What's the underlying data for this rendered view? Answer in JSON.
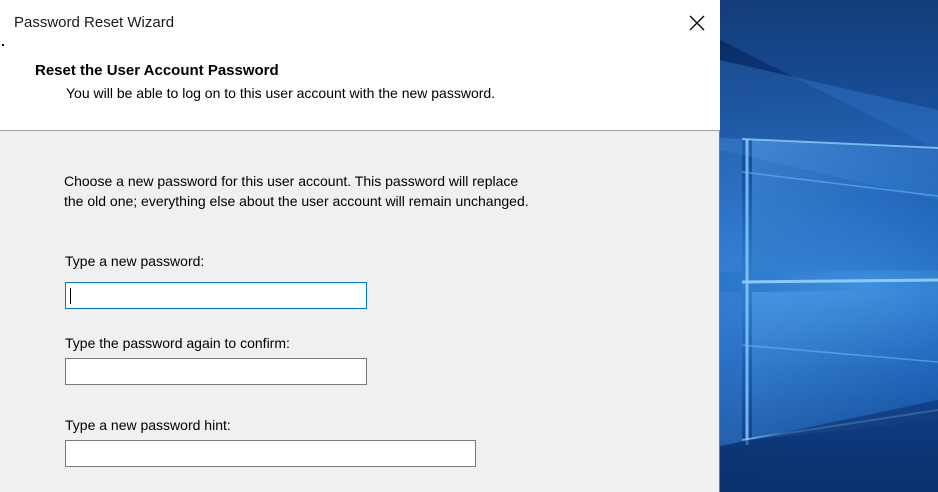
{
  "window": {
    "title": "Password Reset Wizard"
  },
  "header": {
    "title": "Reset the User Account Password",
    "subtitle": "You will be able to log on to this user account with the new password."
  },
  "body": {
    "intro_line1": "Choose a new password for this user account. This password will replace",
    "intro_line2": "the old one; everything else about the user account will remain unchanged.",
    "new_password": {
      "label": "Type a new password:",
      "value": ""
    },
    "confirm_password": {
      "label": "Type the password again to confirm:",
      "value": ""
    },
    "password_hint": {
      "label": "Type a new password hint:",
      "value": ""
    }
  },
  "colors": {
    "focus_border": "#0078d7",
    "window_bg": "#f0f0f0",
    "desktop_accent": "#1b5fb4"
  },
  "icons": {
    "close": "close-icon"
  }
}
